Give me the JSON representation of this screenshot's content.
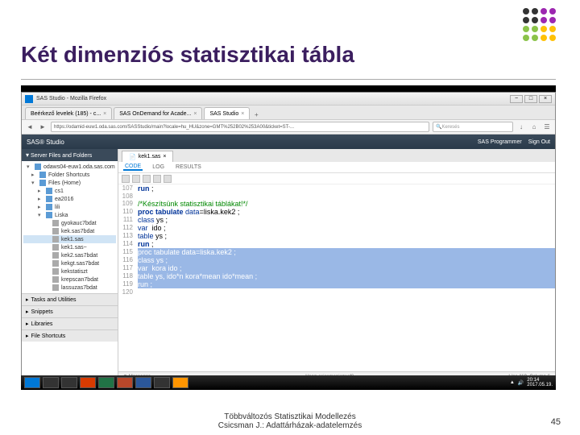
{
  "slide_title": "Két dimenziós statisztikai tábla",
  "browser": {
    "window_title": "SAS Studio - Mozilla Firefox",
    "tabs": [
      {
        "label": "Beérkező levelek (185) - c..."
      },
      {
        "label": "SAS OnDemand for Acade..."
      },
      {
        "label": "SAS Studio"
      }
    ],
    "url": "https://odamid-euw1.oda.sas.com/SASStudio/main?locale=hu_HU&zone=GMT%252B02%253A00&ticket=ST-...",
    "search_placeholder": "Keresés"
  },
  "sas": {
    "product": "SAS® Studio",
    "right_links": {
      "programmer": "SAS Programmer",
      "signout": "Sign Out"
    },
    "sidebar_header": "Server Files and Folders",
    "tree": [
      {
        "lvl": 0,
        "caret": "▾",
        "icon": "folder-icon",
        "label": "odaws04-euw1.oda.sas.com"
      },
      {
        "lvl": 1,
        "caret": "▸",
        "icon": "folder-icon",
        "label": "Folder Shortcuts"
      },
      {
        "lvl": 1,
        "caret": "▾",
        "icon": "folder-icon",
        "label": "Files (Home)"
      },
      {
        "lvl": 2,
        "caret": "▸",
        "icon": "folder-icon",
        "label": "cs1"
      },
      {
        "lvl": 2,
        "caret": "▸",
        "icon": "folder-icon",
        "label": "ea2016"
      },
      {
        "lvl": 2,
        "caret": "▸",
        "icon": "folder-icon",
        "label": "lili"
      },
      {
        "lvl": 2,
        "caret": "▾",
        "icon": "folder-icon",
        "label": "Liska"
      },
      {
        "lvl": 3,
        "caret": "",
        "icon": "file-icon",
        "label": "gyokauc7bdat"
      },
      {
        "lvl": 3,
        "caret": "",
        "icon": "file-icon",
        "label": "kek.sas7bdat"
      },
      {
        "lvl": 3,
        "caret": "",
        "icon": "file-icon",
        "label": "kek1.sas",
        "selected": true
      },
      {
        "lvl": 3,
        "caret": "",
        "icon": "file-icon",
        "label": "kek1.sas~"
      },
      {
        "lvl": 3,
        "caret": "",
        "icon": "file-icon",
        "label": "kek2.sas7bdat"
      },
      {
        "lvl": 3,
        "caret": "",
        "icon": "file-icon",
        "label": "kekgt.sas7bdat"
      },
      {
        "lvl": 3,
        "caret": "",
        "icon": "file-icon",
        "label": "kekstatiszt"
      },
      {
        "lvl": 3,
        "caret": "",
        "icon": "file-icon",
        "label": "krepscan7bdat"
      },
      {
        "lvl": 3,
        "caret": "",
        "icon": "file-icon",
        "label": "lassuzas7bdat"
      }
    ],
    "side_sections": [
      "Tasks and Utilities",
      "Snippets",
      "Libraries",
      "File Shortcuts"
    ],
    "editor_tab": "kek1.sas",
    "sub_tabs": [
      "CODE",
      "LOG",
      "RESULTS"
    ],
    "active_sub_tab": 0,
    "code": [
      {
        "n": 107,
        "t": "run ;",
        "kw": true
      },
      {
        "n": 108,
        "t": ""
      },
      {
        "n": 109,
        "t": "/*Készítsünk statisztikai táblákat!*/",
        "cm": true
      },
      {
        "n": 110,
        "t": "proc tabulate data=liska.kek2 ;",
        "kw2": "proc tabulate"
      },
      {
        "n": 111,
        "t": "class ys ;",
        "kw3": "class"
      },
      {
        "n": 112,
        "t": "var  ido ;",
        "kw3": "var"
      },
      {
        "n": 113,
        "t": "table ys ;",
        "kw3": "table"
      },
      {
        "n": 114,
        "t": "run ;",
        "kw": true
      },
      {
        "n": 115,
        "t": "proc tabulate data=liska.kek2 ;",
        "sel": true
      },
      {
        "n": 116,
        "t": "class ys ;",
        "sel": true
      },
      {
        "n": 117,
        "t": "var  kora ido ;",
        "sel": true
      },
      {
        "n": 118,
        "t": "table ys, ido*n kora*mean ido*mean ;",
        "sel": true
      },
      {
        "n": 119,
        "t": "run ;",
        "sel": true
      },
      {
        "n": 120,
        "t": ""
      }
    ],
    "status_left": "Messages",
    "status_right": "Line 119, Column 6"
  },
  "taskbar": {
    "time": "20:14",
    "date": "2017.05.19."
  },
  "footer": {
    "line1": "Többváltozós Statisztikai Modellezés",
    "line2": "Csicsman J.: Adattárházak-adatelemzés"
  },
  "page_num": "45"
}
